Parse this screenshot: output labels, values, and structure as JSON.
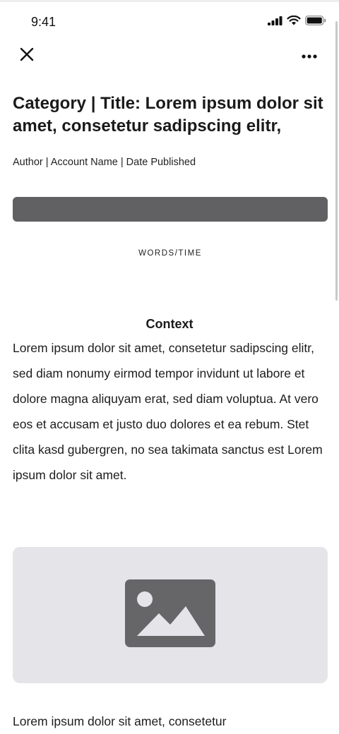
{
  "status_bar": {
    "time": "9:41"
  },
  "nav": {
    "close_icon": "close-icon",
    "more_icon": "more-horizontal-icon"
  },
  "article": {
    "title": "Category | Title: Lorem ipsum dolor sit amet, consetetur sadipscing elitr,",
    "byline": "Author | Account Name | Date Published",
    "words_time": "WORDS/TIME",
    "context_heading": "Context",
    "paragraph_1": "Lorem ipsum dolor sit amet, consetetur sadipscing elitr, sed diam nonumy eirmod tempor invidunt ut labore et dolore magna aliquyam erat, sed diam voluptua. At vero eos et accusam et justo duo dolores et ea rebum. Stet clita kasd gubergren, no sea takimata sanctus est Lorem ipsum dolor sit amet.",
    "image_icon": "image-placeholder-icon",
    "paragraph_2": "Lorem ipsum dolor sit amet, consetetur"
  },
  "colors": {
    "media_bar": "#616163",
    "image_bg": "#e5e5e9",
    "image_icon": "#666668"
  }
}
